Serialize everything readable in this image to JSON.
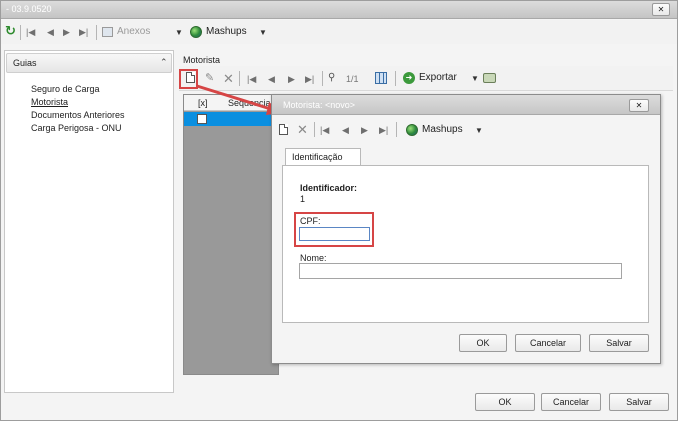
{
  "window": {
    "title": "- 03.9.0520",
    "close_label": "✕"
  },
  "toolbar": {
    "attachments_label": "Anexos",
    "mashups_label": "Mashups"
  },
  "sidebar": {
    "header": "Guias",
    "collapse_glyph": "⌃",
    "items": [
      {
        "label": "Seguro de Carga"
      },
      {
        "label": "Motorista"
      },
      {
        "label": "Documentos Anteriores"
      },
      {
        "label": "Carga Perigosa - ONU"
      }
    ]
  },
  "panel": {
    "title": "Motorista",
    "record_counter": "1/1",
    "export_label": "Exportar",
    "grid": {
      "col_check": "[x]",
      "col_sequence": "Sequencia"
    }
  },
  "dialog": {
    "title": "Motorista: <novo>",
    "close_label": "✕",
    "mashups_label": "Mashups",
    "tab_label": "Identificação",
    "identifier_label": "Identificador:",
    "identifier_value": "1",
    "cpf_label": "CPF:",
    "cpf_value": "",
    "name_label": "Nome:",
    "name_value": "",
    "ok_label": "OK",
    "cancel_label": "Cancelar",
    "save_label": "Salvar"
  },
  "footer": {
    "ok_label": "OK",
    "cancel_label": "Cancelar",
    "save_label": "Salvar"
  },
  "colors": {
    "titlebar": "#c9c9c9",
    "highlight_red": "#d64545",
    "grid_selected_row": "#0a8fe0"
  }
}
